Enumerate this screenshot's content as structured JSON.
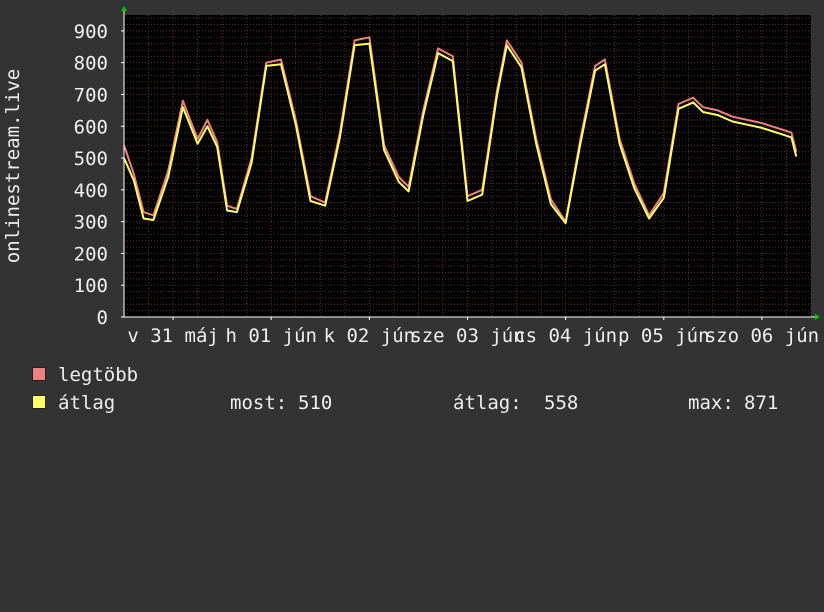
{
  "chart_data": {
    "type": "line",
    "ylabel": "onlinestream.live",
    "ylim": [
      0,
      950
    ],
    "yticks": [
      0,
      100,
      200,
      300,
      400,
      500,
      600,
      700,
      800,
      900
    ],
    "x_tick_labels": [
      "v 31 máj",
      "h 01 jún",
      "k 02 jún",
      "sze 03 jún",
      "cs 04 jún",
      "p 05 jún",
      "szo 06 jún"
    ],
    "x_tick_positions": [
      0.5,
      1.5,
      2.5,
      3.5,
      4.5,
      5.5,
      6.5
    ],
    "x_range_days": [
      0,
      7
    ],
    "grid": true,
    "legend_position": "bottom",
    "colors": {
      "background": "#333333",
      "plot_background": "#000000",
      "grid": "#5a3030",
      "axis": "#ffffff",
      "arrow": "#00cc00",
      "legtobb": "#f08080",
      "atlag": "#ffff66"
    },
    "series": [
      {
        "name": "legtöbb",
        "color": "#f08080",
        "x": [
          0,
          0.1,
          0.2,
          0.3,
          0.45,
          0.6,
          0.75,
          0.85,
          0.95,
          1.05,
          1.15,
          1.3,
          1.45,
          1.6,
          1.75,
          1.9,
          2.05,
          2.2,
          2.35,
          2.5,
          2.65,
          2.8,
          2.9,
          3.05,
          3.2,
          3.35,
          3.5,
          3.65,
          3.8,
          3.9,
          4.05,
          4.2,
          4.35,
          4.5,
          4.65,
          4.8,
          4.9,
          5.05,
          5.2,
          5.35,
          5.5,
          5.65,
          5.8,
          5.9,
          6.05,
          6.2,
          6.35,
          6.5,
          6.6,
          6.7,
          6.8,
          6.85
        ],
        "values": [
          540,
          450,
          330,
          320,
          460,
          680,
          560,
          620,
          550,
          350,
          340,
          500,
          800,
          810,
          620,
          380,
          360,
          580,
          870,
          880,
          540,
          440,
          410,
          650,
          845,
          820,
          380,
          400,
          710,
          870,
          800,
          560,
          370,
          300,
          560,
          790,
          810,
          560,
          420,
          320,
          390,
          670,
          690,
          660,
          650,
          630,
          620,
          610,
          600,
          590,
          580,
          520
        ],
        "note_unused": ""
      },
      {
        "name": "átlag",
        "color": "#ffff66",
        "x": [
          0,
          0.1,
          0.2,
          0.3,
          0.45,
          0.6,
          0.75,
          0.85,
          0.95,
          1.05,
          1.15,
          1.3,
          1.45,
          1.6,
          1.75,
          1.9,
          2.05,
          2.2,
          2.35,
          2.5,
          2.65,
          2.8,
          2.9,
          3.05,
          3.2,
          3.35,
          3.5,
          3.65,
          3.8,
          3.9,
          4.05,
          4.2,
          4.35,
          4.5,
          4.65,
          4.8,
          4.9,
          5.05,
          5.2,
          5.35,
          5.5,
          5.65,
          5.8,
          5.9,
          6.05,
          6.2,
          6.35,
          6.5,
          6.6,
          6.7,
          6.8,
          6.85
        ],
        "values": [
          500,
          430,
          310,
          305,
          440,
          660,
          545,
          600,
          535,
          335,
          330,
          485,
          790,
          795,
          605,
          365,
          350,
          565,
          855,
          860,
          525,
          425,
          395,
          635,
          830,
          805,
          365,
          385,
          695,
          855,
          785,
          545,
          355,
          295,
          545,
          775,
          795,
          545,
          405,
          310,
          375,
          655,
          675,
          645,
          635,
          615,
          605,
          595,
          585,
          575,
          565,
          505
        ]
      }
    ],
    "stats": {
      "now_label": "most:",
      "now_value": "510",
      "avg_label": "átlag:",
      "avg_value": "558",
      "max_label": "max:",
      "max_value": "871"
    }
  }
}
